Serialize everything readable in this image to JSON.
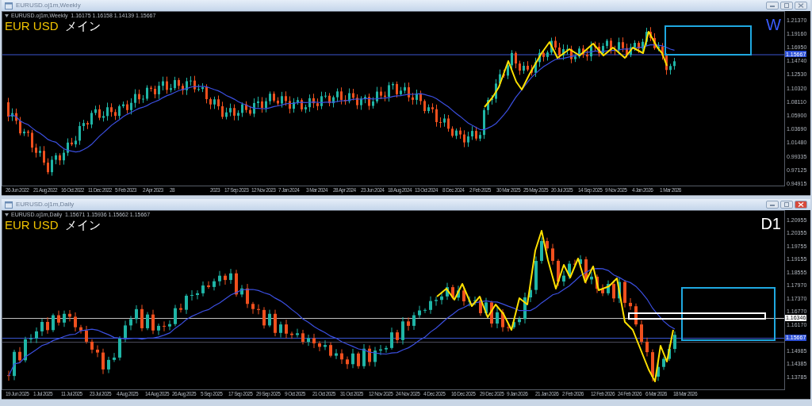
{
  "windows": [
    {
      "kind": "weekly",
      "title": "EURUSD.oj1m,Weekly",
      "info": "EURUSD.oj1m,Weekly  1.16175 1.16158 1.14139 1.15667",
      "symbol": "EUR USD",
      "label": "メイン",
      "timeframe": "W",
      "price_ticks": [
        "1.21370",
        "1.19160",
        "1.16950",
        "1.14740",
        "1.12530",
        "1.10320",
        "1.08110",
        "1.05900",
        "1.03690",
        "1.01480",
        "0.99335",
        "0.97125",
        "0.94915"
      ],
      "price_labels": [
        {
          "kind": "bid",
          "text": "1.15667"
        }
      ],
      "date_ticks": [
        "26 Jun 2022",
        "21 Aug 2022",
        "16 Oct 2022",
        "11 Dec 2022",
        "5 Feb 2023",
        "2 Apr 2023",
        "28",
        "2023",
        "17 Sep 2023",
        "12 Nov 2023",
        "7 Jan 2024",
        "3 Mar 2024",
        "28 Apr 2024",
        "23 Jun 2024",
        "18 Aug 2024",
        "13 Oct 2024",
        "8 Dec 2024",
        "2 Feb 2025",
        "30 Mar 2025",
        "25 May 2025",
        "20 Jul 2025",
        "14 Sep 2025",
        "9 Nov 2025",
        "4 Jan 2026",
        "1 Mar 2026"
      ]
    },
    {
      "kind": "daily",
      "title": "EURUSD.oj1m,Daily",
      "info": "EURUSD.oj1m,Daily  1.15671 1.15936 1.15662 1.15667",
      "symbol": "EUR USD",
      "label": "メイン",
      "timeframe": "D1",
      "price_ticks": [
        "1.20955",
        "1.20355",
        "1.19755",
        "1.19155",
        "1.18555",
        "1.17970",
        "1.17370",
        "1.16770",
        "1.16170",
        "1.14985",
        "1.14385",
        "1.13785"
      ],
      "price_labels": [
        {
          "kind": "line",
          "text": "1.16346"
        },
        {
          "kind": "bid",
          "text": "1.15667"
        }
      ],
      "date_ticks": [
        "19 Jun 2025",
        "1 Jul 2025",
        "11 Jul 2025",
        "23 Jul 2025",
        "4 Aug 2025",
        "14 Aug 2025",
        "26 Aug 2025",
        "5 Sep 2025",
        "17 Sep 2025",
        "29 Sep 2025",
        "9 Oct 2025",
        "21 Oct 2025",
        "31 Oct 2025",
        "12 Nov 2025",
        "24 Nov 2025",
        "4 Dec 2025",
        "16 Dec 2025",
        "29 Dec 2025",
        "9 Jan 2026",
        "21 Jan 2026",
        "2 Feb 2026",
        "12 Feb 2026",
        "24 Feb 2026",
        "6 Mar 2026",
        "18 Mar 2026"
      ]
    }
  ]
}
